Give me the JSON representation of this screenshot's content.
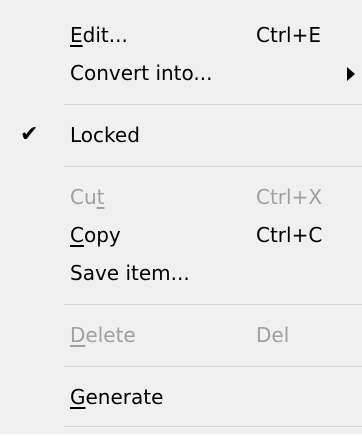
{
  "menu": {
    "edit": {
      "pre": "",
      "mnemonic": "E",
      "post": "dit...",
      "shortcut": "Ctrl+E"
    },
    "convert": {
      "label": "Convert into..."
    },
    "locked": {
      "label": "Locked"
    },
    "cut": {
      "pre": "Cu",
      "mnemonic": "t",
      "post": "",
      "shortcut": "Ctrl+X"
    },
    "copy": {
      "pre": "",
      "mnemonic": "C",
      "post": "opy",
      "shortcut": "Ctrl+C"
    },
    "save": {
      "label": "Save item..."
    },
    "delete": {
      "pre": "",
      "mnemonic": "D",
      "post": "elete",
      "shortcut": "Del"
    },
    "generate": {
      "pre": "",
      "mnemonic": "G",
      "post": "enerate"
    }
  },
  "icons": {
    "check": "✔",
    "submenu_arrow": "triangle-right"
  },
  "colors": {
    "background": "#f0f0f0",
    "text": "#000000",
    "disabled_text": "#a0a0a0",
    "separator": "#d7d7d7"
  }
}
